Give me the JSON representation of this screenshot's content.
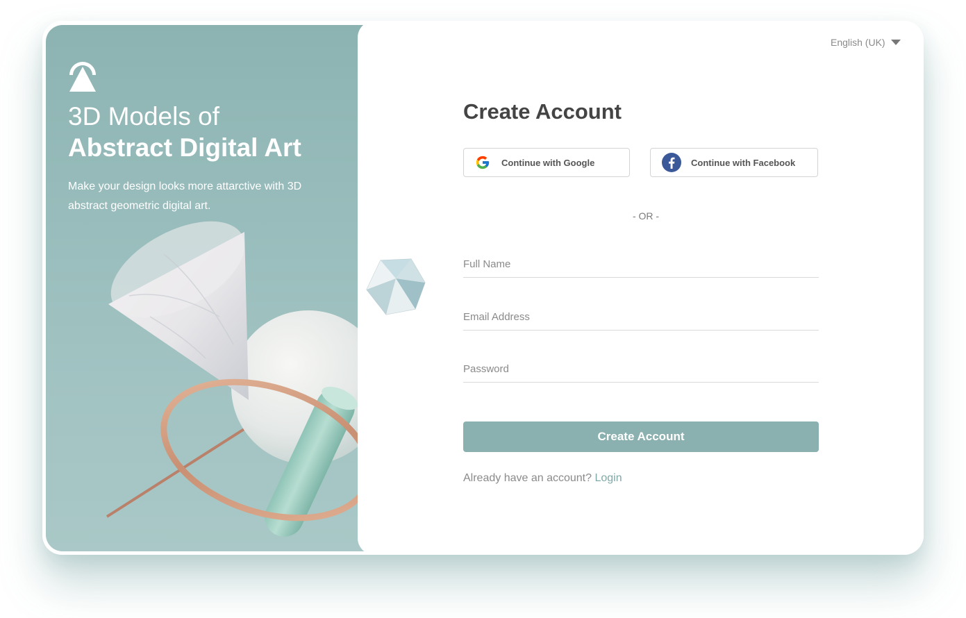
{
  "hero": {
    "title_line1": "3D Models of",
    "title_line2": "Abstract Digital Art",
    "subtitle": "Make your design looks more attarctive with 3D abstract geometric digital art.",
    "logo_icon": "mountain-logo-icon",
    "illustration": "abstract-3d-art-illustration"
  },
  "language": {
    "selected": "English (UK)",
    "icon": "caret-down-icon"
  },
  "form": {
    "title": "Create Account",
    "google_label": "Continue with Google",
    "facebook_label": "Continue with Facebook",
    "divider": "- OR -",
    "full_name_placeholder": "Full Name",
    "email_placeholder": "Email Address",
    "password_placeholder": "Password",
    "submit_label": "Create Account",
    "login_prompt": "Already have an account?",
    "login_link": "Login"
  },
  "colors": {
    "accent": "#8ab0af",
    "hero_bg": "#96bbba",
    "title": "#444444",
    "link": "#7fa8a7"
  }
}
